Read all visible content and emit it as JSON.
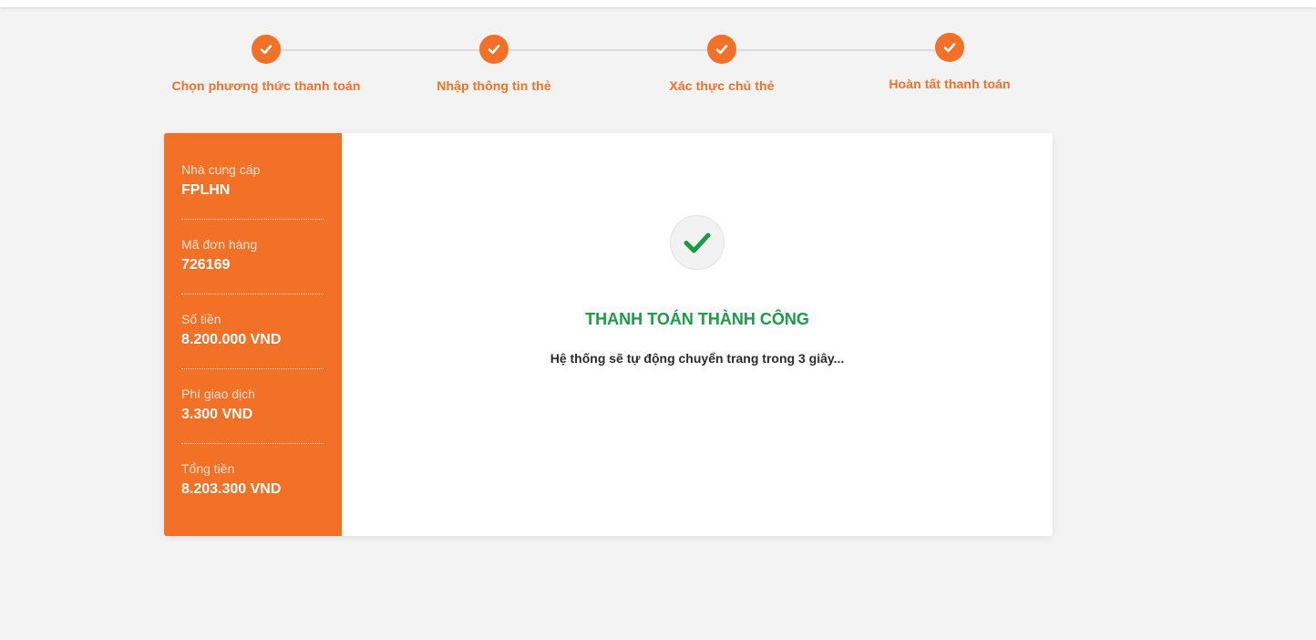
{
  "steps": [
    {
      "label": "Chọn phương thức thanh toán",
      "done": true
    },
    {
      "label": "Nhập thông tin thẻ",
      "done": true
    },
    {
      "label": "Xác thực chủ thẻ",
      "done": true
    },
    {
      "label": "Hoàn tất thanh toán",
      "done": true
    }
  ],
  "order": {
    "provider_label": "Nhà cung cấp",
    "provider_value": "FPLHN",
    "order_id_label": "Mã đơn hàng",
    "order_id_value": "726169",
    "amount_label": "Số tiền",
    "amount_value": "8.200.000 VND",
    "fee_label": "Phí giao dịch",
    "fee_value": "3.300 VND",
    "total_label": "Tổng tiền",
    "total_value": "8.203.300 VND"
  },
  "result": {
    "icon": "check-icon",
    "title": "THANH TOÁN THÀNH CÔNG",
    "message": "Hệ thống sẽ tự động chuyển trang trong 3 giây..."
  },
  "colors": {
    "accent": "#f37027",
    "success": "#1a9b48",
    "background": "#f3f3f3"
  }
}
